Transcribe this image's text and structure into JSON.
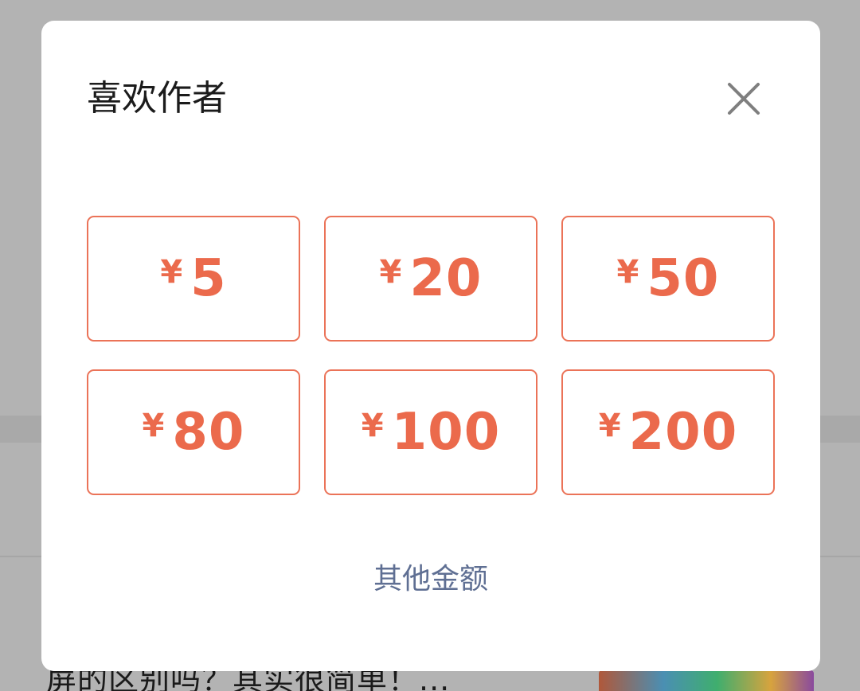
{
  "modal": {
    "title": "喜欢作者",
    "close_icon": "close-icon",
    "currency_symbol": "¥",
    "amounts": [
      "5",
      "20",
      "50",
      "80",
      "100",
      "200"
    ],
    "other_amount_label": "其他金额"
  },
  "background": {
    "article_title": "屏的区别吗？其实很简单！..."
  },
  "colors": {
    "accent": "#eb6a4c",
    "link": "#5f6f93",
    "overlay": "#b3b3b3"
  }
}
